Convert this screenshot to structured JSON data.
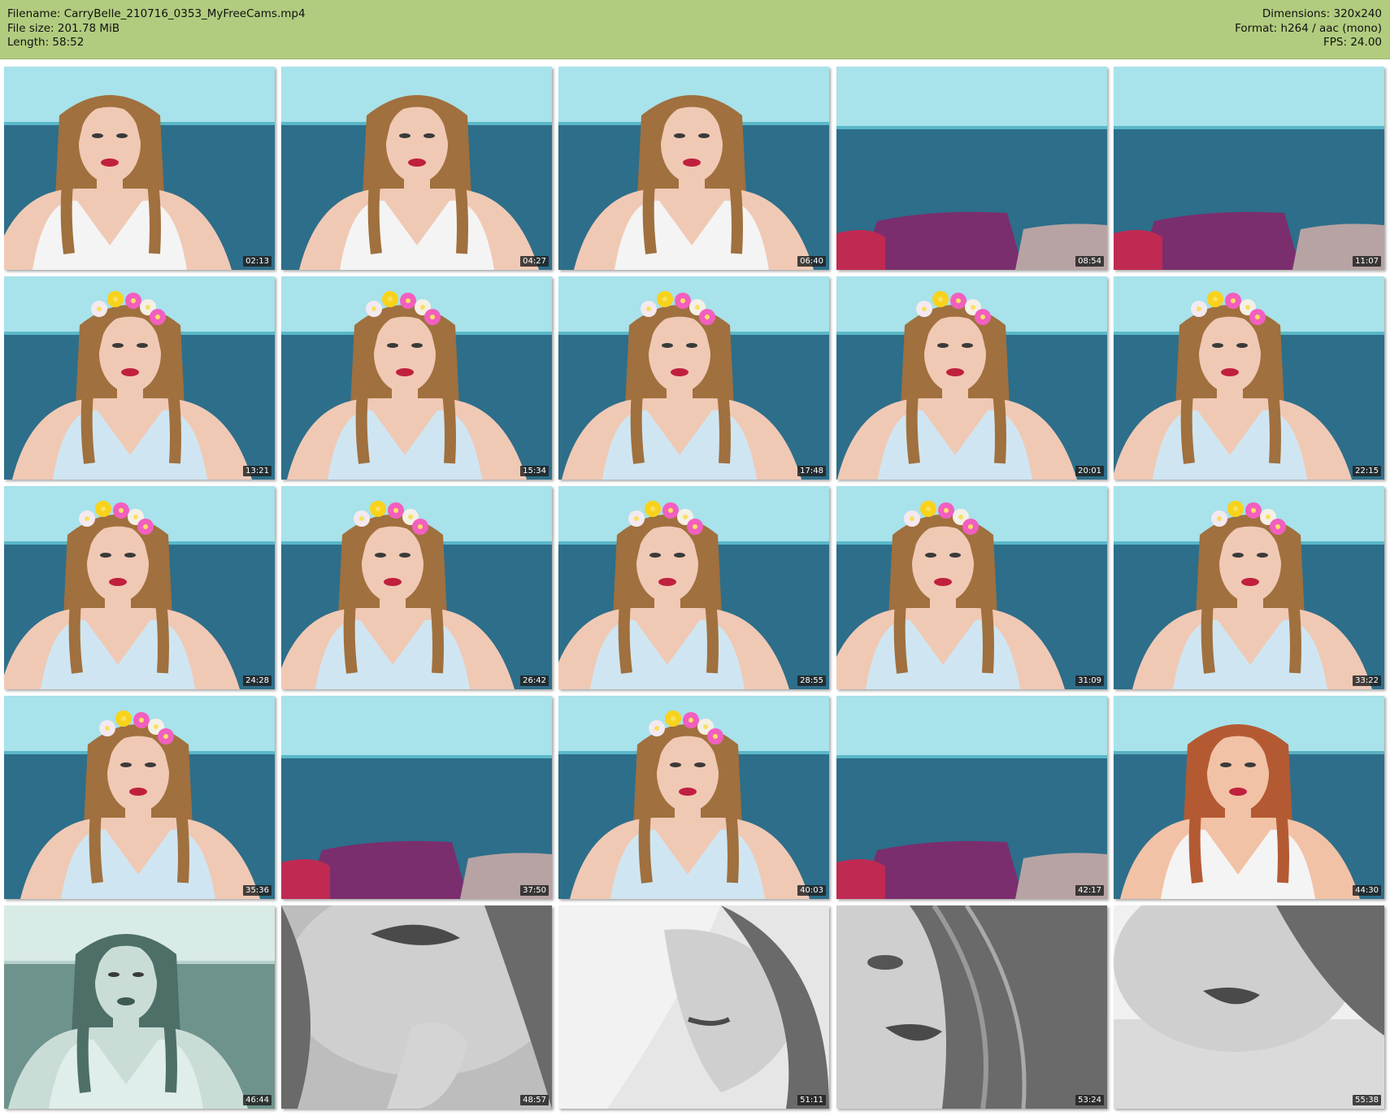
{
  "header": {
    "filename": "Filename: CarryBelle_210716_0353_MyFreeCams.mp4",
    "filesize": "File size: 201.78 MiB",
    "length": "Length: 58:52",
    "dimensions": "Dimensions: 320x240",
    "format": "Format: h264 / aac (mono)",
    "fps": "FPS: 24.00"
  },
  "colors": {
    "header_bg": "#b1cc7f",
    "wall": "#5ab8c8",
    "wall_light": "#a8e2ea",
    "sofa": "#2d6e8a",
    "pillow": "#7a2e6e",
    "skin": "#f0c9b5",
    "hair": "#a0703e",
    "shirt_white": "#f4f4f4",
    "shirt_blue": "#cfe6f2",
    "lips": "#c0203e"
  },
  "thumbnails": [
    {
      "time": "02:13",
      "scene": "person",
      "flowers": false,
      "shirt": "white",
      "tone": "color"
    },
    {
      "time": "04:27",
      "scene": "person",
      "flowers": false,
      "shirt": "white",
      "tone": "color"
    },
    {
      "time": "06:40",
      "scene": "person",
      "flowers": false,
      "shirt": "white",
      "tone": "color"
    },
    {
      "time": "08:54",
      "scene": "empty",
      "tone": "color"
    },
    {
      "time": "11:07",
      "scene": "empty",
      "tone": "color"
    },
    {
      "time": "13:21",
      "scene": "person",
      "flowers": true,
      "shirt": "blue",
      "tone": "color"
    },
    {
      "time": "15:34",
      "scene": "person",
      "flowers": true,
      "shirt": "blue",
      "tone": "color"
    },
    {
      "time": "17:48",
      "scene": "person",
      "flowers": true,
      "shirt": "blue",
      "tone": "color"
    },
    {
      "time": "20:01",
      "scene": "person",
      "flowers": true,
      "shirt": "blue",
      "tone": "color"
    },
    {
      "time": "22:15",
      "scene": "person",
      "flowers": true,
      "shirt": "blue",
      "tone": "color"
    },
    {
      "time": "24:28",
      "scene": "person",
      "flowers": true,
      "shirt": "blue",
      "tone": "color"
    },
    {
      "time": "26:42",
      "scene": "person",
      "flowers": true,
      "shirt": "blue",
      "tone": "color"
    },
    {
      "time": "28:55",
      "scene": "person",
      "flowers": true,
      "shirt": "blue",
      "tone": "color"
    },
    {
      "time": "31:09",
      "scene": "person",
      "flowers": true,
      "shirt": "blue",
      "tone": "color"
    },
    {
      "time": "33:22",
      "scene": "person",
      "flowers": true,
      "shirt": "blue",
      "tone": "color"
    },
    {
      "time": "35:36",
      "scene": "person",
      "flowers": true,
      "shirt": "blue",
      "tone": "color"
    },
    {
      "time": "37:50",
      "scene": "empty",
      "tone": "color"
    },
    {
      "time": "40:03",
      "scene": "person",
      "flowers": true,
      "shirt": "blue",
      "tone": "color"
    },
    {
      "time": "42:17",
      "scene": "empty",
      "tone": "color"
    },
    {
      "time": "44:30",
      "scene": "person",
      "flowers": false,
      "shirt": "white",
      "tone": "warm"
    },
    {
      "time": "46:44",
      "scene": "person",
      "flowers": false,
      "shirt": "white",
      "tone": "teal"
    },
    {
      "time": "48:57",
      "scene": "closeup",
      "tone": "gray"
    },
    {
      "time": "51:11",
      "scene": "closeup",
      "tone": "gray"
    },
    {
      "time": "53:24",
      "scene": "closeup",
      "tone": "gray"
    },
    {
      "time": "55:38",
      "scene": "closeup",
      "tone": "gray"
    }
  ]
}
